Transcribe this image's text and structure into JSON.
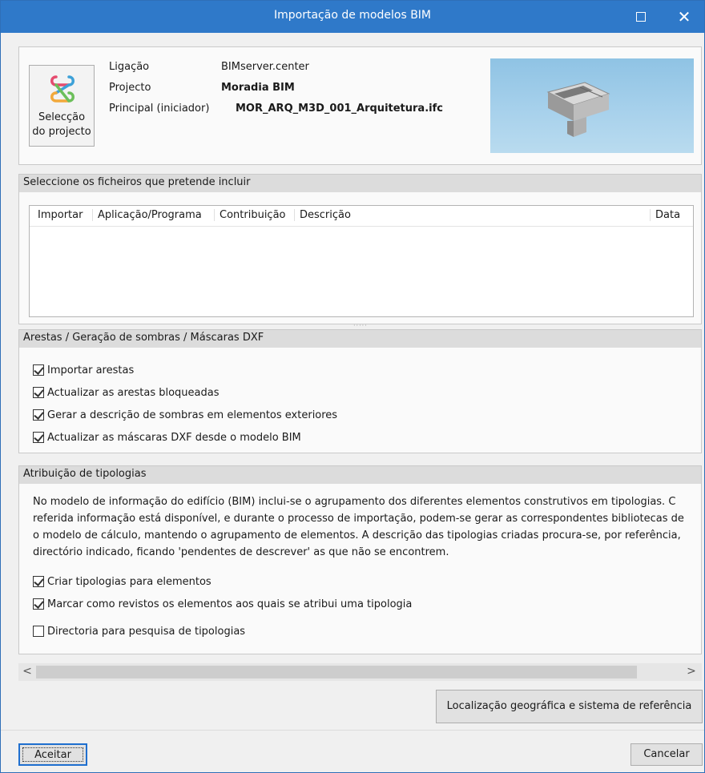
{
  "window": {
    "title": "Importação de modelos BIM",
    "maximize_label": "□",
    "close_label": "✕"
  },
  "project": {
    "select_button_line1": "Selecção",
    "select_button_line2": "do projecto",
    "fields": [
      {
        "label": "Ligação",
        "value": "BIMserver.center"
      },
      {
        "label": "Projecto",
        "value": "Moradia BIM"
      },
      {
        "label": "Principal (iniciador)",
        "value": "MOR_ARQ_M3D_001_Arquitetura.ifc"
      }
    ]
  },
  "files": {
    "section_title": "Seleccione os ficheiros que pretende incluir",
    "columns": [
      "Importar",
      "Aplicação/Programa",
      "Contribuição",
      "Descrição",
      "Data"
    ],
    "rows": []
  },
  "edges": {
    "section_title": "Arestas / Geração de sombras / Máscaras DXF",
    "options": [
      {
        "label": "Importar arestas",
        "checked": true
      },
      {
        "label": "Actualizar as arestas bloqueadas",
        "checked": true
      },
      {
        "label": "Gerar a descrição de sombras em elementos exteriores",
        "checked": true
      },
      {
        "label": "Actualizar as máscaras DXF desde o modelo BIM",
        "checked": true
      }
    ]
  },
  "typologies": {
    "section_title": "Atribuição de tipologias",
    "paragraph_lines": [
      "No modelo de informação do edifício (BIM) inclui-se o agrupamento dos diferentes elementos construtivos em tipologias. C",
      "referida informação está disponível, e durante o processo de importação, podem-se gerar as correspondentes bibliotecas de",
      "o modelo de cálculo, mantendo o agrupamento de elementos. A descrição das tipologias criadas procura-se, por referência,",
      "directório indicado, ficando 'pendentes de descrever' as que não se encontrem."
    ],
    "options": [
      {
        "label": "Criar tipologias para elementos",
        "checked": true
      },
      {
        "label": "Marcar como revistos os elementos aos quais se atribui uma tipologia",
        "checked": true
      },
      {
        "label": "Directoria para pesquisa de tipologias",
        "checked": false
      }
    ]
  },
  "scrollbar": {
    "left_arrow": "<",
    "right_arrow": ">"
  },
  "buttons": {
    "geo": "Localização geográfica e sistema de referência",
    "ok": "Aceitar",
    "cancel": "Cancelar"
  },
  "colors": {
    "titlebar": "#2f79c9",
    "section_header": "#dcdcdc",
    "panel": "#fafafa"
  }
}
